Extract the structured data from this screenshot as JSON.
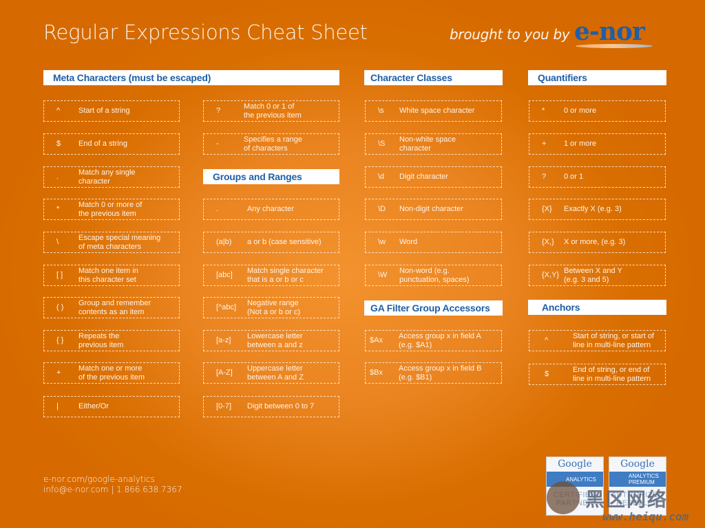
{
  "title": "Regular Expressions Cheat Sheet",
  "brought_by": "brought to you by",
  "logo": {
    "text": "e-nor",
    "icon": "globe-icon"
  },
  "colors": {
    "background": "#d96e00",
    "header_text": "#1f5fa6",
    "header_bg": "#ffffff"
  },
  "sections": {
    "meta": {
      "title": "Meta Characters (must be escaped)",
      "items": [
        {
          "sym": "^",
          "desc": "Start of a string"
        },
        {
          "sym": "$",
          "desc": "End of a string"
        },
        {
          "sym": ".",
          "desc": "Match any single\ncharacter"
        },
        {
          "sym": "*",
          "desc": "Match 0 or more of\nthe previous item"
        },
        {
          "sym": "\\",
          "desc": "Escape special meaning\nof meta characters"
        },
        {
          "sym": "[ ]",
          "desc": "Match one item in\nthis character set"
        },
        {
          "sym": "( )",
          "desc": "Group and remember\ncontents as an item"
        },
        {
          "sym": "{ }",
          "desc": "Repeats the\nprevious item"
        },
        {
          "sym": "+",
          "desc": "Match one or more\nof the previous item"
        },
        {
          "sym": "|",
          "desc": "Either/Or"
        }
      ],
      "items2": [
        {
          "sym": "?",
          "desc": "Match 0 or 1 of\nthe previous item"
        },
        {
          "sym": "-",
          "desc": "Specifies a range\nof characters"
        }
      ]
    },
    "groups": {
      "title": "Groups and Ranges",
      "items": [
        {
          "sym": ".",
          "desc": "Any character"
        },
        {
          "sym": "(a|b)",
          "desc": "a or b (case sensitive)"
        },
        {
          "sym": "[abc]",
          "desc": "Match single character\nthat is a or b or c"
        },
        {
          "sym": "[^abc]",
          "desc": "Negative range\n(Not a or b or c)"
        },
        {
          "sym": "[a-z]",
          "desc": "Lowercase letter\nbetween a and z"
        },
        {
          "sym": "[A-Z]",
          "desc": "Uppercase letter\nbetween A and Z"
        },
        {
          "sym": "[0-7]",
          "desc": "Digit between 0 to 7"
        }
      ]
    },
    "classes": {
      "title": "Character Classes",
      "items": [
        {
          "sym": "\\s",
          "desc": "White space character"
        },
        {
          "sym": "\\S",
          "desc": "Non-white space\ncharacter"
        },
        {
          "sym": "\\d",
          "desc": "Digit character"
        },
        {
          "sym": "\\D",
          "desc": "Non-digit character"
        },
        {
          "sym": "\\w",
          "desc": "Word"
        },
        {
          "sym": "\\W",
          "desc": "Non-word (e.g.\npunctuation, spaces)"
        }
      ]
    },
    "ga": {
      "title": "GA Filter Group Accessors",
      "items": [
        {
          "sym": "$Ax",
          "desc": "Access group x in field A\n(e.g. $A1)"
        },
        {
          "sym": "$Bx",
          "desc": "Access group x in field B\n(e.g. $B1)"
        }
      ]
    },
    "quantifiers": {
      "title": "Quantifiers",
      "items": [
        {
          "sym": "*",
          "desc": "0 or more"
        },
        {
          "sym": "+",
          "desc": "1 or more"
        },
        {
          "sym": "?",
          "desc": "0 or 1"
        },
        {
          "sym": "{X}",
          "desc": "Exactly X (e.g. 3)"
        },
        {
          "sym": "{X,}",
          "desc": "X or more, (e.g. 3)"
        },
        {
          "sym": "{X,Y}",
          "desc": "Between X and Y\n(e.g. 3 and 5)"
        }
      ]
    },
    "anchors": {
      "title": "Anchors",
      "items": [
        {
          "sym": "^",
          "desc": "Start of string, or start of\nline in multi-line pattern"
        },
        {
          "sym": "$",
          "desc": "End of string, or end of\nline in multi-line pattern"
        }
      ]
    }
  },
  "footer": {
    "line1": "e-nor.com/google-analytics",
    "line2": "info@e-nor.com | 1.866.638.7367"
  },
  "badges": [
    {
      "brand": "Google",
      "product": "ANALYTICS",
      "status": "CERTIFIED\nPARTNER"
    },
    {
      "brand": "Google",
      "product": "ANALYTICS\nPREMIUM",
      "status": "AUTHORIZED\nRESELLER"
    }
  ],
  "watermark": {
    "text": "黑区网络",
    "url": "www.heiqu.com"
  }
}
